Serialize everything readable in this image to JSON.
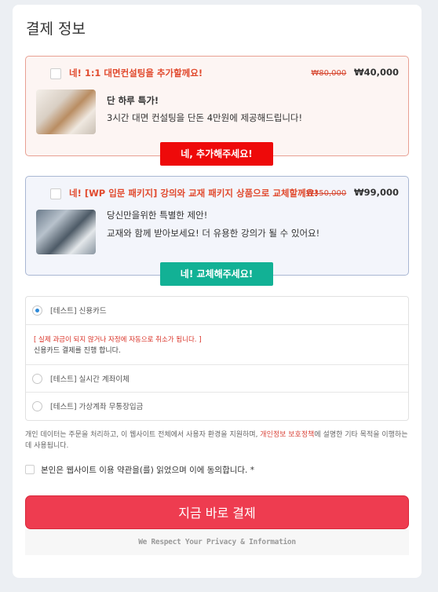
{
  "title": "결제 정보",
  "offers": [
    {
      "headline": "네! 1:1 대면컨설팅을 추가할께요!",
      "old_price": "₩80,000",
      "new_price": "₩40,000",
      "line1": "단 하루 특가!",
      "line2": "3시간 대면 컨설팅을 단돈 4만원에 제공해드립니다!",
      "cta": "네, 추가해주세요!"
    },
    {
      "headline": "네! [WP 입문 패키지] 강의와 교재 패키지 상품으로 교체할께요!",
      "old_price": "₩350,000",
      "new_price": "₩99,000",
      "line1": "당신만을위한 특별한 제안!",
      "line2": "교재와 함께 받아보세요! 더 유용한 강의가 될 수 있어요!",
      "cta": "네! 교체해주세요!"
    }
  ],
  "payment": {
    "methods": [
      {
        "label": "[테스트] 신용카드",
        "selected": true
      },
      {
        "label": "[테스트] 실시간 계좌이체",
        "selected": false
      },
      {
        "label": "[테스트] 가상계좌 무통장입금",
        "selected": false
      }
    ],
    "warning": "[ 실제 과금이 되지 않거나 자정에 자동으로 취소가 됩니다. ]",
    "info": "신용카드 결제를 진행 합니다."
  },
  "privacy": {
    "before": "개인 데이터는 주문을 처리하고, 이 웹사이트 전체에서 사용자 환경을 지원하며, ",
    "link": "개인정보 보호정책",
    "after": "에 설명한 기타 목적을 이행하는 데 사용됩니다."
  },
  "agree_label": "본인은 웹사이트 이용 약관을(를) 읽었으며 이에 동의합니다. *",
  "pay_button": "지금 바로 결제",
  "respect_text": "We Respect Your Privacy & Information",
  "colors": {
    "accent_red": "#ee3c50",
    "cta_red": "#ee0a0a",
    "cta_teal": "#12b195",
    "radio_selected": "#2e8ad8"
  }
}
